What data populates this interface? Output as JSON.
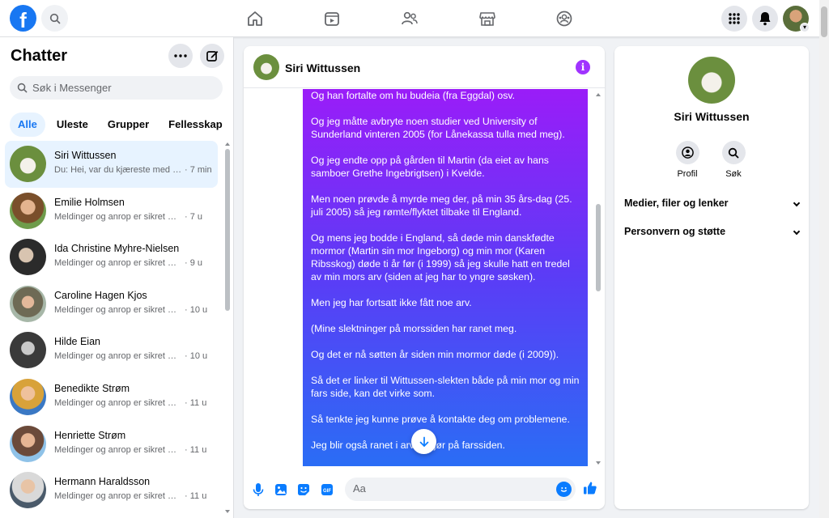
{
  "topnav": {
    "logo_letter": "f",
    "icons": [
      "home-icon",
      "watch-icon",
      "friends-icon",
      "marketplace-icon",
      "groups-icon"
    ],
    "right_icons": [
      "menu-grid-icon",
      "notifications-bell-icon"
    ]
  },
  "sidebar": {
    "title": "Chatter",
    "search_placeholder": "Søk i Messenger",
    "filters": [
      "Alle",
      "Uleste",
      "Grupper",
      "Fellesskap"
    ],
    "active_filter": "Alle",
    "conversations": [
      {
        "name": "Siri Wittussen",
        "snippet": "Du: Hei, var du kjæreste med mi...",
        "time": "· 7 min",
        "active": true
      },
      {
        "name": "Emilie Holmsen",
        "snippet": "Meldinger og anrop er sikret med ...",
        "time": "· 7 u"
      },
      {
        "name": "Ida Christine Myhre-Nielsen",
        "snippet": "Meldinger og anrop er sikret med ...",
        "time": "· 9 u"
      },
      {
        "name": "Caroline Hagen Kjos",
        "snippet": "Meldinger og anrop er sikret me...",
        "time": "· 10 u"
      },
      {
        "name": "Hilde Eian",
        "snippet": "Meldinger og anrop er sikret me...",
        "time": "· 10 u"
      },
      {
        "name": "Benedikte Strøm",
        "snippet": "Meldinger og anrop er sikret me...",
        "time": "· 11 u"
      },
      {
        "name": "Henriette Strøm",
        "snippet": "Meldinger og anrop er sikret me...",
        "time": "· 11 u"
      },
      {
        "name": "Hermann Haraldsson",
        "snippet": "Meldinger og anrop er sikret me...",
        "time": "· 11 u"
      }
    ]
  },
  "chat": {
    "contact_name": "Siri Wittussen",
    "messages": [
      "Og han fortalte om hu budeia (fra Eggdal) osv.",
      "Og jeg måtte avbryte noen studier ved University of Sunderland vinteren 2005 (for Lånekassa tulla med meg).",
      "Og jeg endte opp på gården til Martin (da eiet av hans samboer Grethe Ingebrigtsen) i Kvelde.",
      "Men noen prøvde å myrde meg der, på min 35 års-dag (25. juli 2005) så jeg rømte/flyktet tilbake til England.",
      "Og mens jeg bodde i England, så døde min danskfødte mormor (Martin sin mor Ingeborg) og min mor (Karen Ribsskog) døde ti år før (i 1999) så jeg skulle hatt en tredel av min mors arv (siden at jeg har to yngre søsken).",
      "Men jeg har fortsatt ikke fått noe arv.",
      "(Mine slektninger på morssiden har ranet meg.",
      "Og det er nå søtten år siden min mormor døde (i 2009)).",
      "Så det er linker til Wittussen-slekten både på min mor og min fars side, kan det virke som.",
      "Så tenkte jeg kunne prøve å kontakte deg om problemene.",
      "Jeg blir også ranet i arven       gjør på farssiden."
    ],
    "composer_placeholder": "Aa"
  },
  "info_panel": {
    "name": "Siri Wittussen",
    "actions": [
      {
        "label": "Profil",
        "icon": "profile-icon"
      },
      {
        "label": "Søk",
        "icon": "search-icon"
      }
    ],
    "sections": [
      "Medier, filer og lenker",
      "Personvern og støtte"
    ]
  },
  "colors": {
    "accent": "#1877f2",
    "bubble_top": "#9b1cf8",
    "bubble_bottom": "#2a6df5",
    "info_icon": "#a033ff"
  }
}
